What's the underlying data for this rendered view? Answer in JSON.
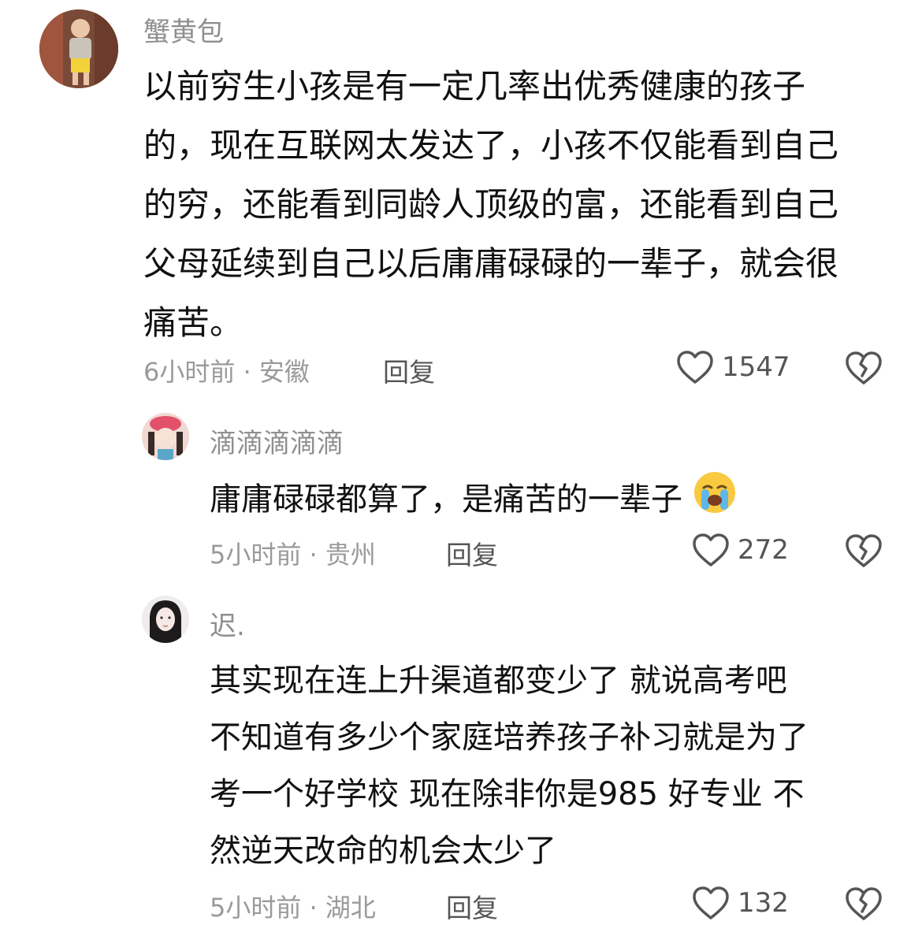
{
  "comments": [
    {
      "username": "蟹黄包",
      "lines": [
        "以前穷生小孩是有一定几率出优秀健康的孩子",
        "的，现在互联网太发达了，小孩不仅能看到自己",
        "的穷，还能看到同龄人顶级的富，还能看到自己",
        "父母延续到自己以后庸庸碌碌的一辈子，就会很",
        "痛苦。"
      ],
      "meta": "6小时前 · 安徽",
      "reply_label": "回复",
      "likes": "1547"
    },
    {
      "username": "滴滴滴滴滴",
      "lines": [
        "庸庸碌碌都算了，是痛苦的一辈子"
      ],
      "emoji_icon": "crying-face-icon",
      "meta": "5小时前 · 贵州",
      "reply_label": "回复",
      "likes": "272"
    },
    {
      "username": "迟.",
      "lines": [
        "其实现在连上升渠道都变少了 就说高考吧",
        "不知道有多少个家庭培养孩子补习就是为了",
        "考一个好学校 现在除非你是985 好专业 不",
        "然逆天改命的机会太少了"
      ],
      "meta": "5小时前 · 湖北",
      "reply_label": "回复",
      "likes": "132"
    }
  ],
  "icons": {
    "like": "heart-outline-icon",
    "dislike": "broken-heart-icon"
  },
  "colors": {
    "text": "#111111",
    "muted": "#9a9a9a",
    "icon": "#555555"
  }
}
